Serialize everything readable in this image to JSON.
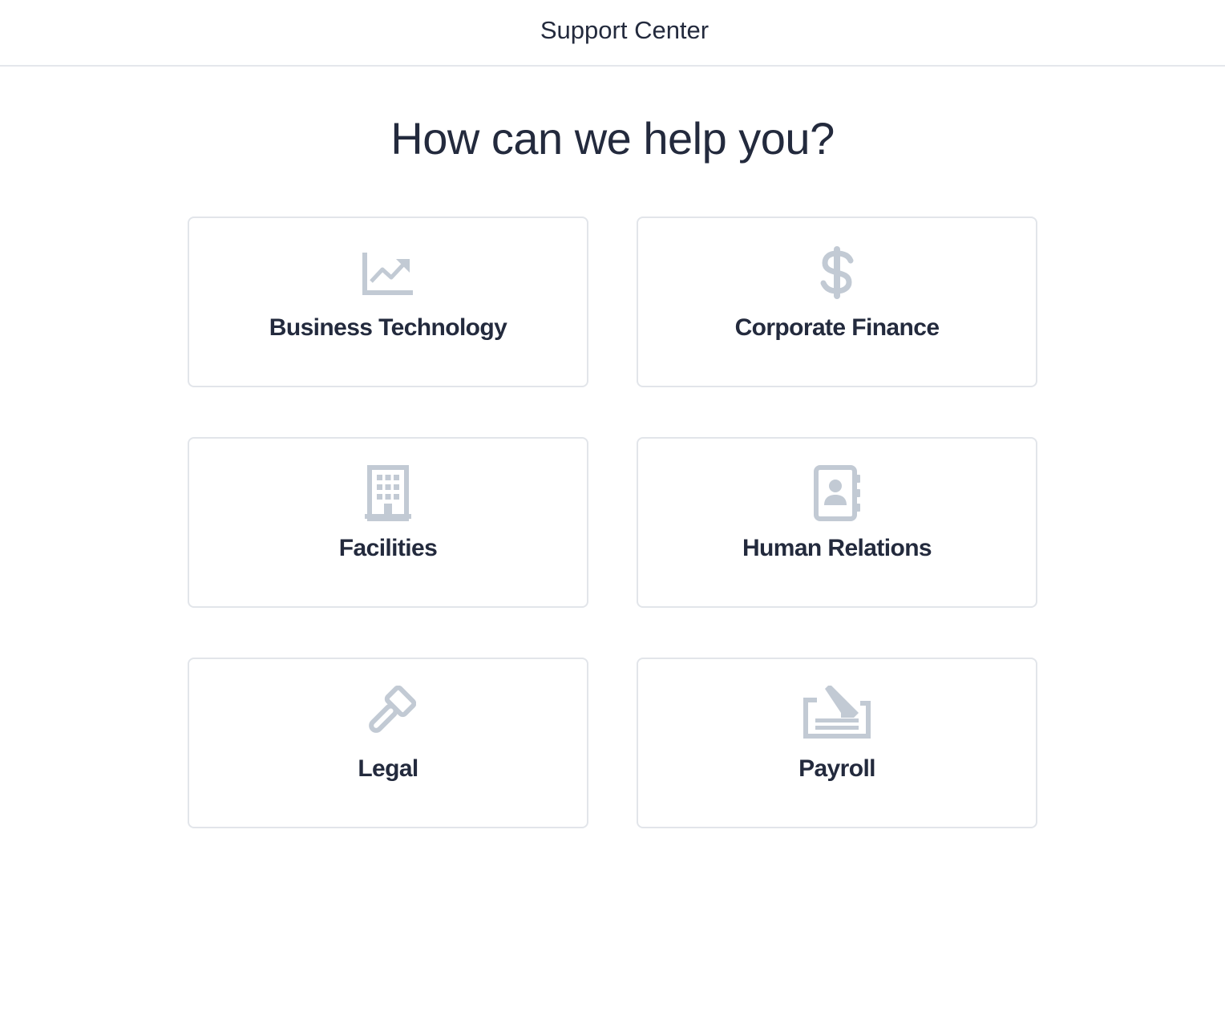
{
  "header": {
    "title": "Support Center"
  },
  "main": {
    "headline": "How can we help you?",
    "icon_color": "#c2cad4",
    "cards": [
      {
        "label": "Business Technology",
        "icon": "chart-line-icon"
      },
      {
        "label": "Corporate Finance",
        "icon": "dollar-sign-icon"
      },
      {
        "label": "Facilities",
        "icon": "building-icon"
      },
      {
        "label": "Human Relations",
        "icon": "address-book-icon"
      },
      {
        "label": "Legal",
        "icon": "gavel-icon"
      },
      {
        "label": "Payroll",
        "icon": "signature-icon"
      }
    ]
  }
}
